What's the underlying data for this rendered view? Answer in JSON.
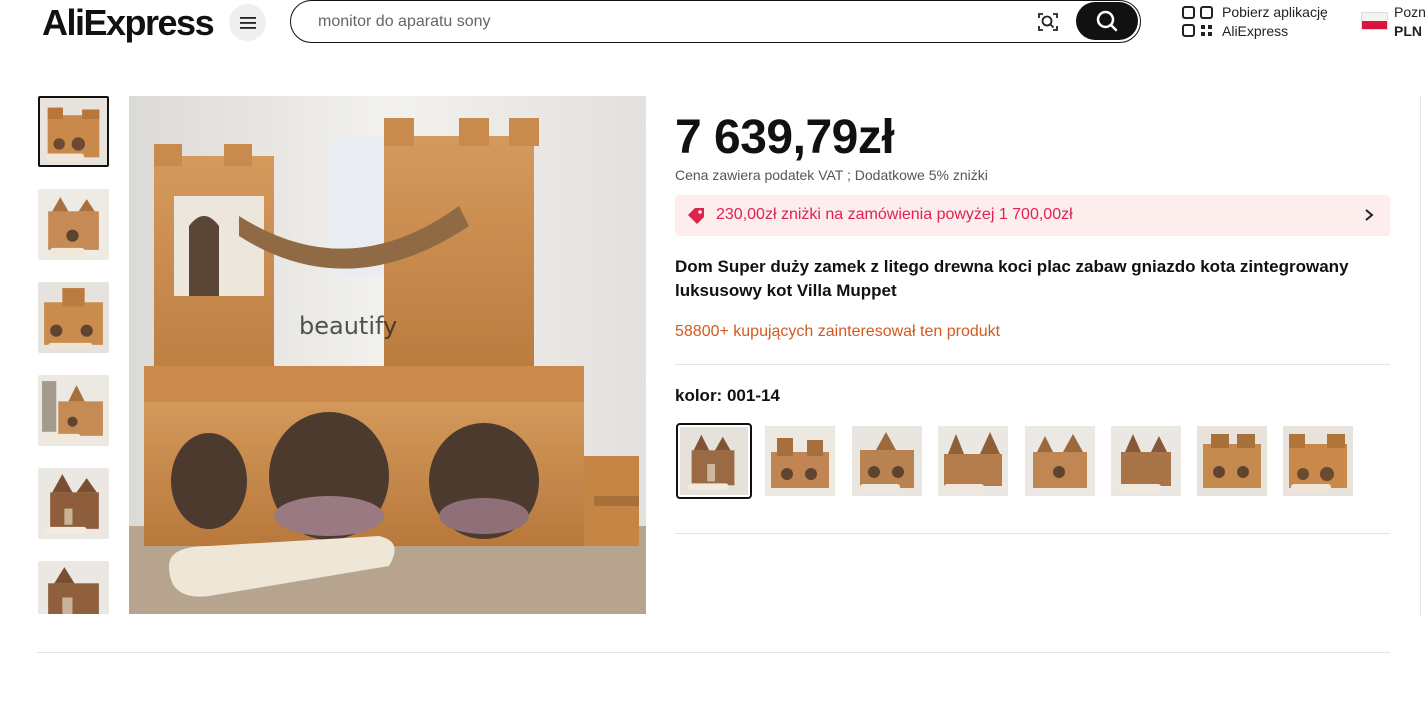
{
  "header": {
    "logo_text": "AliExpress",
    "search_value": "monitor do aparatu sony",
    "app_line1": "Pobierz aplikację",
    "app_line2": "AliExpress",
    "lang_line1": "Pozn",
    "currency": "PLN",
    "icons": [
      "menu-icon",
      "camera-search-icon",
      "search-icon",
      "qr-code-icon",
      "poland-flag-icon"
    ]
  },
  "gallery": {
    "thumbnail_count": 6,
    "active_thumbnail": 1,
    "main_image_watermark": "beautify"
  },
  "product": {
    "price": "7 639,79zł",
    "tax_note": "Cena zawiera podatek VAT ; Dodatkowe 5% zniżki",
    "promo_text": "230,00zł zniżki na zamówienia powyżej 1 700,00zł",
    "title": "Dom Super duży zamek z litego drewna koci plac zabaw gniazdo kota zintegrowany luksusowy kot Villa Muppet",
    "interest": "58800+ kupujących zainteresował ten produkt",
    "color_label": "kolor: ",
    "color_value": "001-14",
    "swatch_count": 8,
    "active_swatch": 1
  },
  "colors": {
    "promo_bg": "#fdeded",
    "promo_text": "#e0234e",
    "interest_text": "#d35a20",
    "wood": "#c8894a"
  }
}
